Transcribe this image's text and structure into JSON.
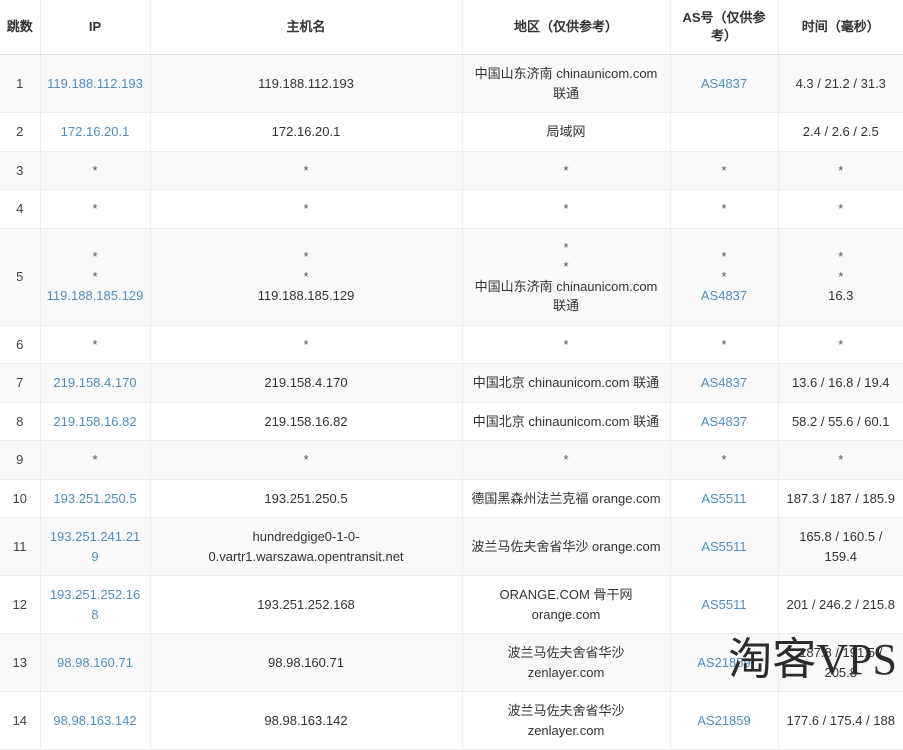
{
  "table": {
    "columns": [
      {
        "key": "hop",
        "label": "跳数"
      },
      {
        "key": "ip",
        "label": "IP"
      },
      {
        "key": "host",
        "label": "主机名"
      },
      {
        "key": "region",
        "label": "地区（仅供参考）"
      },
      {
        "key": "as",
        "label": "AS号（仅供参考）"
      },
      {
        "key": "time",
        "label": "时间（毫秒）"
      }
    ],
    "rows": [
      {
        "hop": "1",
        "ip": [
          "119.188.112.193"
        ],
        "ip_is_link": true,
        "host": [
          "119.188.112.193"
        ],
        "region": [
          "中国山东济南 chinaunicom.com 联通"
        ],
        "as": [
          "AS4837"
        ],
        "as_is_link": true,
        "time": [
          "4.3 / 21.2 / 31.3"
        ]
      },
      {
        "hop": "2",
        "ip": [
          "172.16.20.1"
        ],
        "ip_is_link": true,
        "host": [
          "172.16.20.1"
        ],
        "region": [
          "局域网"
        ],
        "as": [
          ""
        ],
        "as_is_link": false,
        "time": [
          "2.4 / 2.6 / 2.5"
        ]
      },
      {
        "hop": "3",
        "ip": [
          "*"
        ],
        "ip_is_link": false,
        "host": [
          "*"
        ],
        "region": [
          "*"
        ],
        "as": [
          "*"
        ],
        "as_is_link": false,
        "time": [
          "*"
        ]
      },
      {
        "hop": "4",
        "ip": [
          "*"
        ],
        "ip_is_link": false,
        "host": [
          "*"
        ],
        "region": [
          "*"
        ],
        "as": [
          "*"
        ],
        "as_is_link": false,
        "time": [
          "*"
        ]
      },
      {
        "hop": "5",
        "ip": [
          "*",
          "*",
          "119.188.185.129"
        ],
        "ip_is_link": true,
        "host": [
          "*",
          "*",
          "119.188.185.129"
        ],
        "region": [
          "*",
          "*",
          "中国山东济南 chinaunicom.com 联通"
        ],
        "as": [
          "*",
          "*",
          "AS4837"
        ],
        "as_is_link": true,
        "time": [
          "*",
          "*",
          "16.3"
        ]
      },
      {
        "hop": "6",
        "ip": [
          "*"
        ],
        "ip_is_link": false,
        "host": [
          "*"
        ],
        "region": [
          "*"
        ],
        "as": [
          "*"
        ],
        "as_is_link": false,
        "time": [
          "*"
        ]
      },
      {
        "hop": "7",
        "ip": [
          "219.158.4.170"
        ],
        "ip_is_link": true,
        "host": [
          "219.158.4.170"
        ],
        "region": [
          "中国北京 chinaunicom.com 联通"
        ],
        "as": [
          "AS4837"
        ],
        "as_is_link": true,
        "time": [
          "13.6 / 16.8 / 19.4"
        ]
      },
      {
        "hop": "8",
        "ip": [
          "219.158.16.82"
        ],
        "ip_is_link": true,
        "host": [
          "219.158.16.82"
        ],
        "region": [
          "中国北京 chinaunicom.com 联通"
        ],
        "as": [
          "AS4837"
        ],
        "as_is_link": true,
        "time": [
          "58.2 / 55.6 / 60.1"
        ]
      },
      {
        "hop": "9",
        "ip": [
          "*"
        ],
        "ip_is_link": false,
        "host": [
          "*"
        ],
        "region": [
          "*"
        ],
        "as": [
          "*"
        ],
        "as_is_link": false,
        "time": [
          "*"
        ]
      },
      {
        "hop": "10",
        "ip": [
          "193.251.250.5"
        ],
        "ip_is_link": true,
        "host": [
          "193.251.250.5"
        ],
        "region": [
          "德国黑森州法兰克福 orange.com"
        ],
        "as": [
          "AS5511"
        ],
        "as_is_link": true,
        "time": [
          "187.3 / 187 / 185.9"
        ]
      },
      {
        "hop": "11",
        "ip": [
          "193.251.241.219"
        ],
        "ip_is_link": true,
        "host": [
          "hundredgige0-1-0-0.vartr1.warszawa.opentransit.net"
        ],
        "region": [
          "波兰马佐夫舍省华沙 orange.com"
        ],
        "as": [
          "AS5511"
        ],
        "as_is_link": true,
        "time": [
          "165.8 / 160.5 / 159.4"
        ]
      },
      {
        "hop": "12",
        "ip": [
          "193.251.252.168"
        ],
        "ip_is_link": true,
        "host": [
          "193.251.252.168"
        ],
        "region": [
          "ORANGE.COM 骨干网 orange.com"
        ],
        "as": [
          "AS5511"
        ],
        "as_is_link": true,
        "time": [
          "201 / 246.2 / 215.8"
        ]
      },
      {
        "hop": "13",
        "ip": [
          "98.98.160.71"
        ],
        "ip_is_link": true,
        "host": [
          "98.98.160.71"
        ],
        "region": [
          "波兰马佐夫舍省华沙 zenlayer.com"
        ],
        "as": [
          "AS21859"
        ],
        "as_is_link": true,
        "time": [
          "187.8 / 191.5 / 205.8"
        ]
      },
      {
        "hop": "14",
        "ip": [
          "98.98.163.142"
        ],
        "ip_is_link": true,
        "host": [
          "98.98.163.142"
        ],
        "region": [
          "波兰马佐夫舍省华沙 zenlayer.com"
        ],
        "as": [
          "AS21859"
        ],
        "as_is_link": true,
        "time": [
          "177.6 / 175.4 / 188"
        ]
      }
    ]
  },
  "watermark": {
    "text": "淘客VPS"
  },
  "colors": {
    "link": "#4f8fbf",
    "text": "#333333",
    "stripe": "#f9f9f9",
    "border": "#eeeeee",
    "header_border": "#dddddd"
  }
}
